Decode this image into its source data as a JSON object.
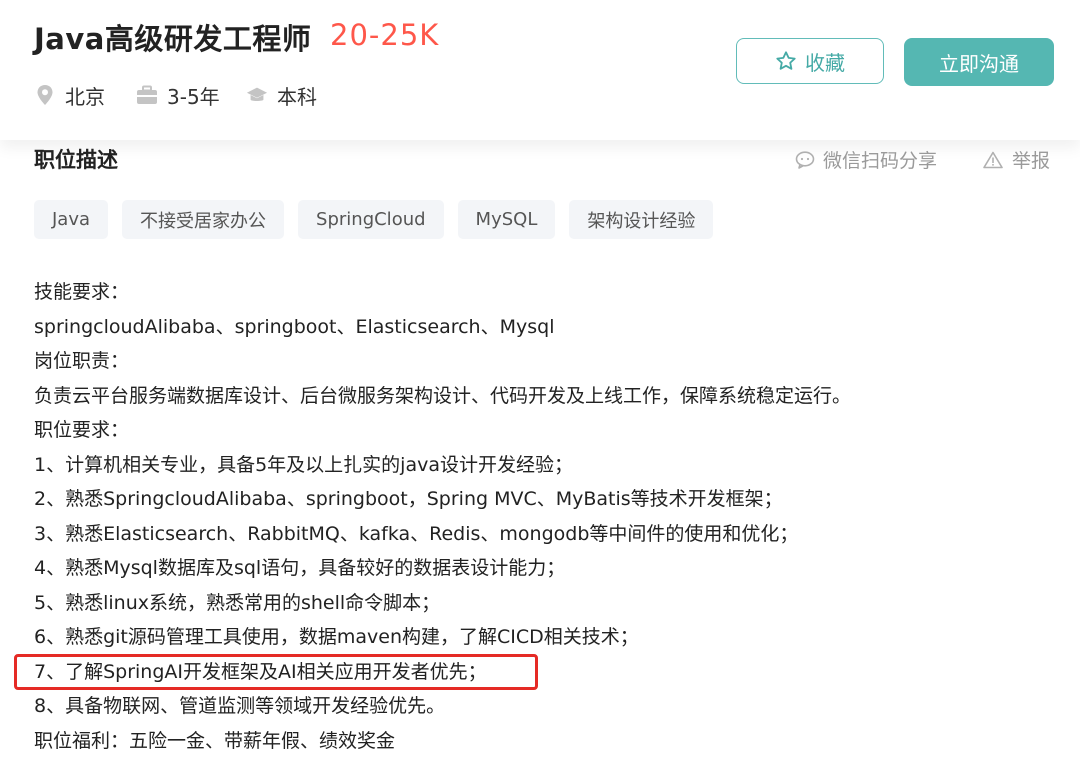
{
  "header": {
    "job_title": "Java高级研发工程师",
    "salary": "20-25K",
    "city": "北京",
    "experience": "3-5年",
    "education": "本科",
    "favorite_label": "收藏",
    "chat_label": "立即沟通",
    "accent_color": "#55b7b2",
    "salary_color": "#fe574a"
  },
  "section": {
    "title": "职位描述",
    "share_label": "微信扫码分享",
    "report_label": "举报"
  },
  "tags": [
    "Java",
    "不接受居家办公",
    "SpringCloud",
    "MySQL",
    "架构设计经验"
  ],
  "description": {
    "lines": [
      "技能要求：",
      "springcloudAlibaba、springboot、Elasticsearch、Mysql",
      "岗位职责：",
      "负责云平台服务端数据库设计、后台微服务架构设计、代码开发及上线工作，保障系统稳定运行。",
      "职位要求：",
      "1、计算机相关专业，具备5年及以上扎实的java设计开发经验；",
      "2、熟悉SpringcloudAlibaba、springboot，Spring MVC、MyBatis等技术开发框架；",
      "3、熟悉Elasticsearch、RabbitMQ、kafka、Redis、mongodb等中间件的使用和优化；",
      "4、熟悉Mysql数据库及sql语句，具备较好的数据表设计能力；",
      "5、熟悉linux系统，熟悉常用的shell命令脚本；",
      "6、熟悉git源码管理工具使用，数据maven构建，了解CICD相关技术；",
      "7、了解SpringAI开发框架及AI相关应用开发者优先；",
      "8、具备物联网、管道监测等领域开发经验优先。",
      "职位福利：五险一金、带薪年假、绩效奖金"
    ],
    "highlight_color": "#e52a25"
  }
}
